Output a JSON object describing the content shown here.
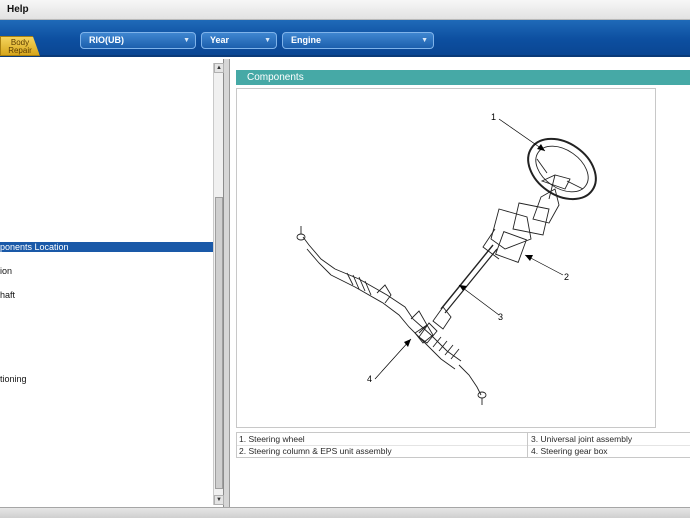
{
  "menu": {
    "help_label": "Help"
  },
  "toolbar": {
    "tab_line1": "Body",
    "tab_line2": "Repair",
    "model_select": "RIO(UB)",
    "year_select": "Year",
    "engine_select": "Engine"
  },
  "tree": {
    "items": [
      {
        "label": "ponents Location",
        "selected": true
      },
      {
        "label": "ion",
        "selected": false
      },
      {
        "label": "haft",
        "selected": false
      },
      {
        "label": "tioning",
        "selected": false
      }
    ]
  },
  "content": {
    "section_title": "Components",
    "figure": {
      "callouts": [
        "1",
        "2",
        "3",
        "4"
      ]
    },
    "legend": [
      {
        "text": "1. Steering wheel"
      },
      {
        "text": "3. Universal joint assembly"
      },
      {
        "text": "2. Steering column & EPS unit assembly"
      },
      {
        "text": "4. Steering gear box"
      }
    ]
  },
  "colors": {
    "toolbar_blue": "#0d4fa0",
    "section_header_teal": "#46a9a6",
    "selection_blue": "#1a59a8",
    "tab_gold": "#d6a61c"
  }
}
